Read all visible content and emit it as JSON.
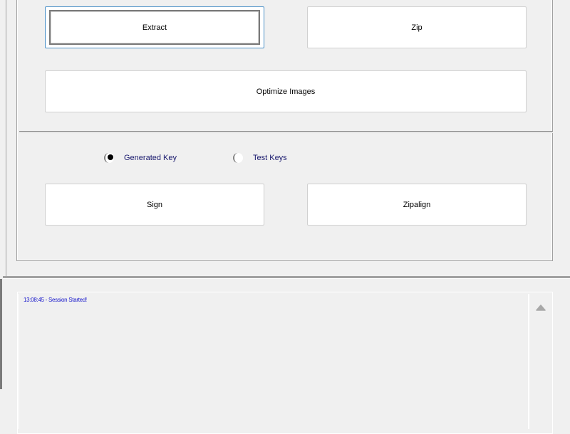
{
  "buttons": {
    "extract": "Extract",
    "zip": "Zip",
    "optimize_images": "Optimize Images",
    "sign": "Sign",
    "zipalign": "Zipalign"
  },
  "key_options": {
    "selected": "Generated Key",
    "items": [
      {
        "label": "Generated Key",
        "checked": true
      },
      {
        "label": "Test Keys",
        "checked": false
      }
    ]
  },
  "log": {
    "lines": [
      "13:08:45 - Session Started!"
    ]
  },
  "icons": {
    "scroll_up": "triangle-up-icon"
  },
  "colors": {
    "log_text": "#1a1acc",
    "radio_label": "#1a1a6e",
    "focus_border": "#4a90c8"
  }
}
